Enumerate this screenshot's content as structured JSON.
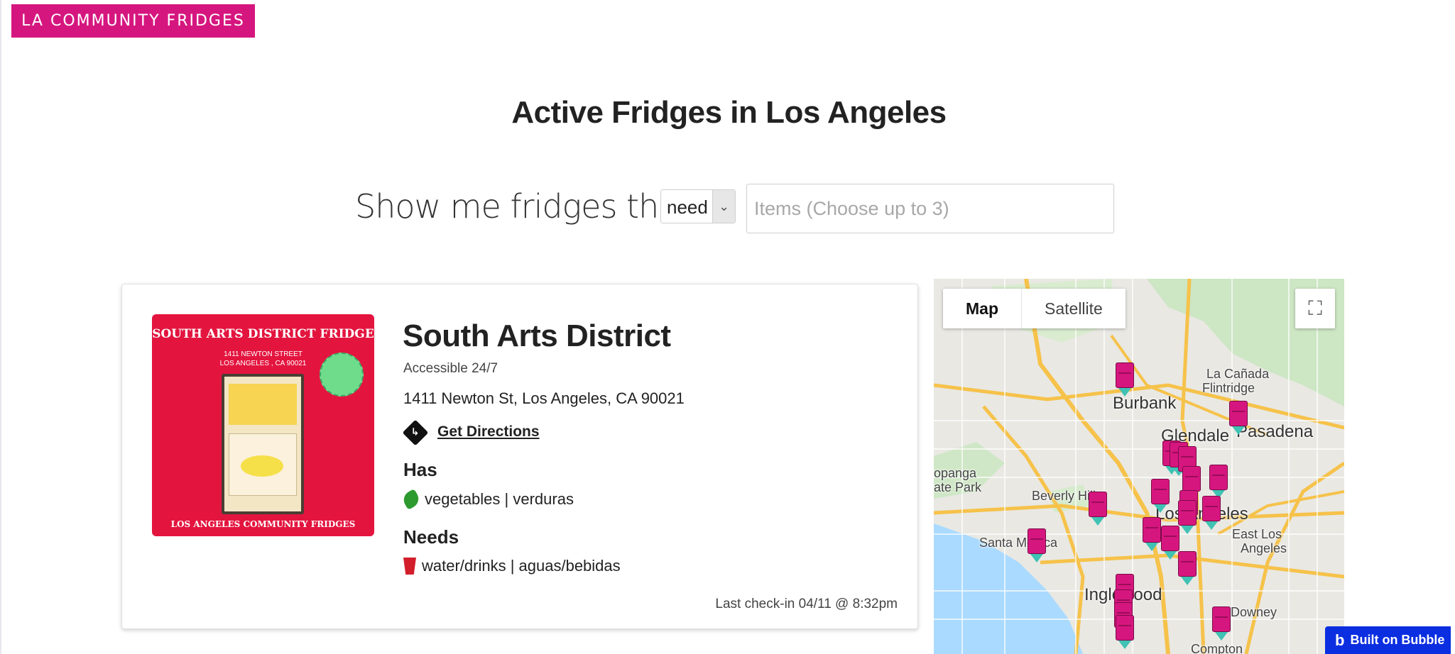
{
  "header": {
    "logo_text": "LA COMMUNITY FRIDGES"
  },
  "page": {
    "title": "Active Fridges in Los Angeles"
  },
  "filter": {
    "label": "Show me fridges that",
    "mode_value": "need",
    "items_placeholder": "Items (Choose up to 3)"
  },
  "fridge": {
    "photo": {
      "title": "SOUTH ARTS DISTRICT FRIDGE",
      "address_line1": "1411 NEWTON STREET",
      "address_line2": "LOS ANGELES , CA 90021",
      "footer": "LOS ANGELES COMMUNITY FRIDGES"
    },
    "name": "South Arts District",
    "access": "Accessible 24/7",
    "address": "1411 Newton St, Los Angeles, CA 90021",
    "directions_label": "Get Directions",
    "has_heading": "Has",
    "has_items": "vegetables | verduras",
    "needs_heading": "Needs",
    "needs_items": "water/drinks | aguas/bebidas",
    "last_checkin": "Last check-in 04/11 @ 8:32pm"
  },
  "map": {
    "tabs": {
      "map": "Map",
      "satellite": "Satellite"
    },
    "places": {
      "burbank": "Burbank",
      "glendale": "Glendale",
      "pasadena": "Pasadena",
      "la_canada": "La Cañada",
      "flintridge": "Flintridge",
      "beverly_hills": "Beverly Hills",
      "los_angeles": "Los Angeles",
      "east_la": "East Los",
      "angeles": "Angeles",
      "santa_monica": "Santa Monica",
      "inglewood": "Inglewood",
      "downey": "Downey",
      "compton": "Compton",
      "topanga": "opanga",
      "state_park": "ate Park"
    },
    "marker_color": "#d6167f"
  },
  "badge": {
    "label": "Built on Bubble"
  }
}
